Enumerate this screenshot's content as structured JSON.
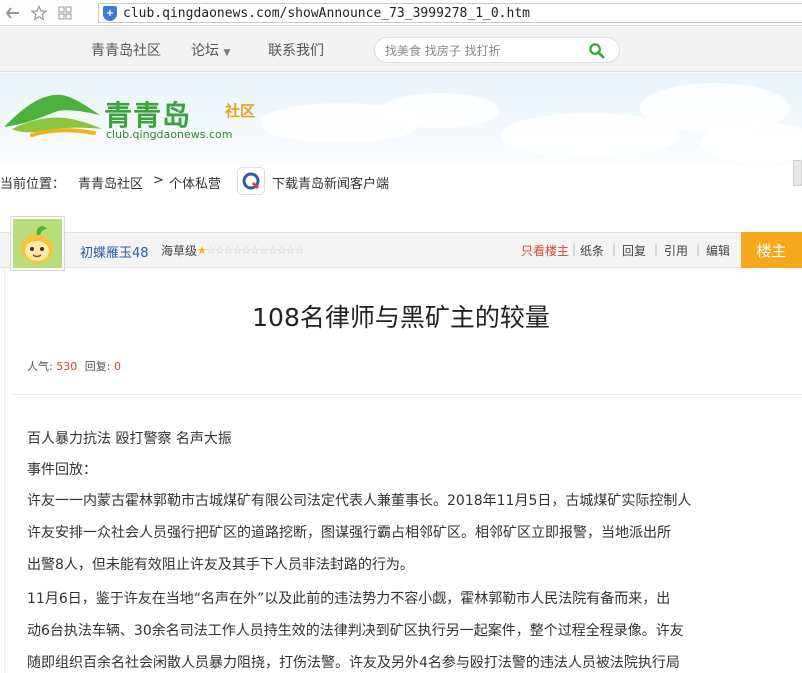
{
  "browser": {
    "url": "club.qingdaonews.com/showAnnounce_73_3999278_1_0.htm",
    "icons": [
      "back-icon",
      "home-icon",
      "grid-icon",
      "shield-icon"
    ]
  },
  "topnav": {
    "items": [
      "青青岛社区",
      "论坛",
      "联系我们"
    ],
    "search_placeholder": "找美食 找房子 找打折"
  },
  "banner": {
    "logo_title": "青青岛",
    "logo_sub": "社区",
    "logo_url": "club.qingdaonews.com"
  },
  "breadcrumb": {
    "label": "当前位置：",
    "home": "青青岛社区",
    "separator": ">",
    "current": "个体私营",
    "download": "下载青岛新闻客户端"
  },
  "post": {
    "username": "初蝶雁玉48",
    "level": "海草级",
    "stars": "★☆☆☆☆☆☆☆☆☆☆☆",
    "actions": [
      "只看楼主",
      "纸条",
      "回复",
      "引用",
      "编辑"
    ],
    "floor": "楼主",
    "title": "108名律师与黑矿主的较量",
    "views_label": "人气:",
    "views": "530",
    "replies_label": "回复:",
    "replies": "0",
    "lines": [
      "百人暴力抗法 殴打警察 名声大振",
      "事件回放：",
      "许友一一内蒙古霍林郭勒市古城煤矿有限公司法定代表人兼董事长。2018年11月5日，古城煤矿实际控制人",
      "许友安排一众社会人员强行把矿区的道路挖断，图谋强行霸占相邻矿区。相邻矿区立即报警，当地派出所",
      "出警8人，但未能有效阻止许友及其手下人员非法封路的行为。",
      "11月6日，鉴于许友在当地“名声在外”以及此前的违法势力不容小觑，霍林郭勒市人民法院有备而来，出",
      "动6台执法车辆、30余名司法工作人员持生效的法律判决到矿区执行另一起案件，整个过程全程录像。许友",
      "随即组织百余名社会闲散人员暴力阻挠，打伤法警。许友及另外4名参与殴打法警的违法人员被法院执行局"
    ]
  },
  "colors": {
    "accent_orange": "#f5a81c",
    "link_blue": "#2a5fa8",
    "highlight_red": "#d9462e",
    "logo_green": "#3aa33a"
  }
}
